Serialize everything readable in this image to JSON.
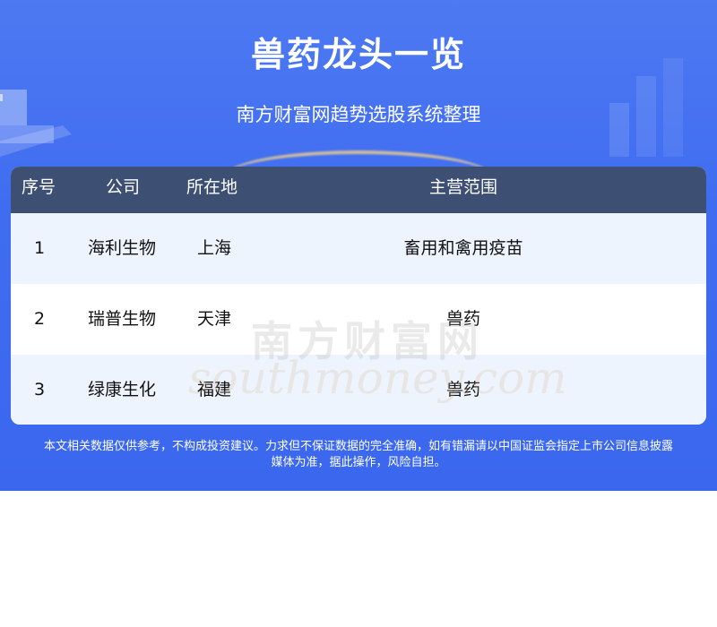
{
  "header": {
    "title": "兽药龙头一览",
    "subtitle": "南方财富网趋势选股系统整理"
  },
  "table": {
    "columns": [
      "序号",
      "公司",
      "所在地",
      "主营范围"
    ],
    "rows": [
      {
        "no": "1",
        "company": "海利生物",
        "location": "上海",
        "business": "畜用和禽用疫苗"
      },
      {
        "no": "2",
        "company": "瑞普生物",
        "location": "天津",
        "business": "兽药"
      },
      {
        "no": "3",
        "company": "绿康生化",
        "location": "福建",
        "business": "兽药"
      }
    ]
  },
  "watermark": {
    "cn": "南方财富网",
    "en": "southmoney.com"
  },
  "footer": {
    "line1": "本文相关数据仅供参考，不构成投资建议。力求但不保证数据的完全准确，如有错漏请以中国证监会指定上市公司信息披露",
    "line2": "媒体为准，据此操作，风险自担。"
  },
  "colors": {
    "banner": "#4272f0",
    "table_header": "#3d4f72",
    "row_tint": "#eef4fd"
  }
}
